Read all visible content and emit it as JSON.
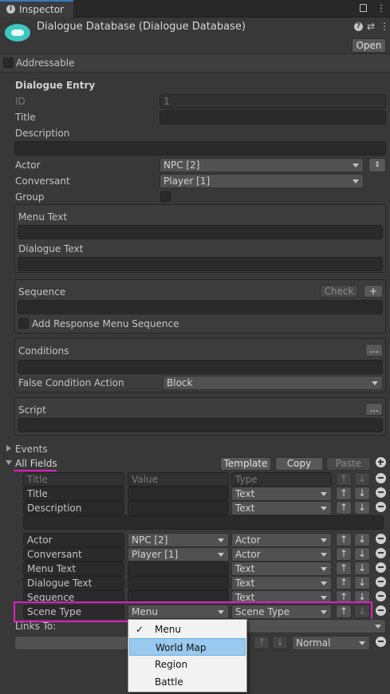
{
  "tab": {
    "title": "Inspector"
  },
  "header": {
    "title": "Dialogue Database (Dialogue Database)",
    "open_label": "Open"
  },
  "addressable": {
    "label": "Addressable"
  },
  "entry": {
    "section_title": "Dialogue Entry",
    "id_label": "ID",
    "id_value": "1",
    "title_label": "Title",
    "title_value": "",
    "description_label": "Description",
    "actor_label": "Actor",
    "actor_value": "NPC [2]",
    "conversant_label": "Conversant",
    "conversant_value": "Player [1]",
    "group_label": "Group",
    "menu_text_label": "Menu Text",
    "dialogue_text_label": "Dialogue Text",
    "sequence_label": "Sequence",
    "check_label": "Check",
    "plus_label": "+",
    "add_response_label": "Add Response Menu Sequence",
    "conditions_label": "Conditions",
    "ellipsis_label": "...",
    "false_action_label": "False Condition Action",
    "false_action_value": "Block",
    "script_label": "Script"
  },
  "events": {
    "label": "Events"
  },
  "all_fields": {
    "label": "All Fields",
    "template_label": "Template",
    "copy_label": "Copy",
    "paste_label": "Paste",
    "header": {
      "title": "Title",
      "value": "Value",
      "type": "Type"
    },
    "rows": [
      {
        "title": "Title",
        "value": "",
        "type": "Text"
      },
      {
        "title": "Description",
        "value": "",
        "type": "Text"
      },
      {
        "title": "Actor",
        "value": "NPC [2]",
        "type": "Actor"
      },
      {
        "title": "Conversant",
        "value": "Player [1]",
        "type": "Actor"
      },
      {
        "title": "Menu Text",
        "value": "",
        "type": "Text"
      },
      {
        "title": "Dialogue Text",
        "value": "",
        "type": "Text"
      },
      {
        "title": "Sequence",
        "value": "",
        "type": "Text"
      },
      {
        "title": "Scene Type",
        "value": "Menu",
        "type": "Scene Type"
      }
    ],
    "up_arrow": "↑",
    "down_arrow": "↓"
  },
  "links": {
    "label": "Links To:",
    "priority_value": "Normal"
  },
  "dropdown_menu": {
    "items": [
      "Menu",
      "World Map",
      "Region",
      "Battle"
    ],
    "checked": "Menu",
    "highlighted": "World Map",
    "check_mark": "✓"
  },
  "colors": {
    "highlight_border": "#e020c0",
    "menu_highlight": "#99c9ef"
  }
}
